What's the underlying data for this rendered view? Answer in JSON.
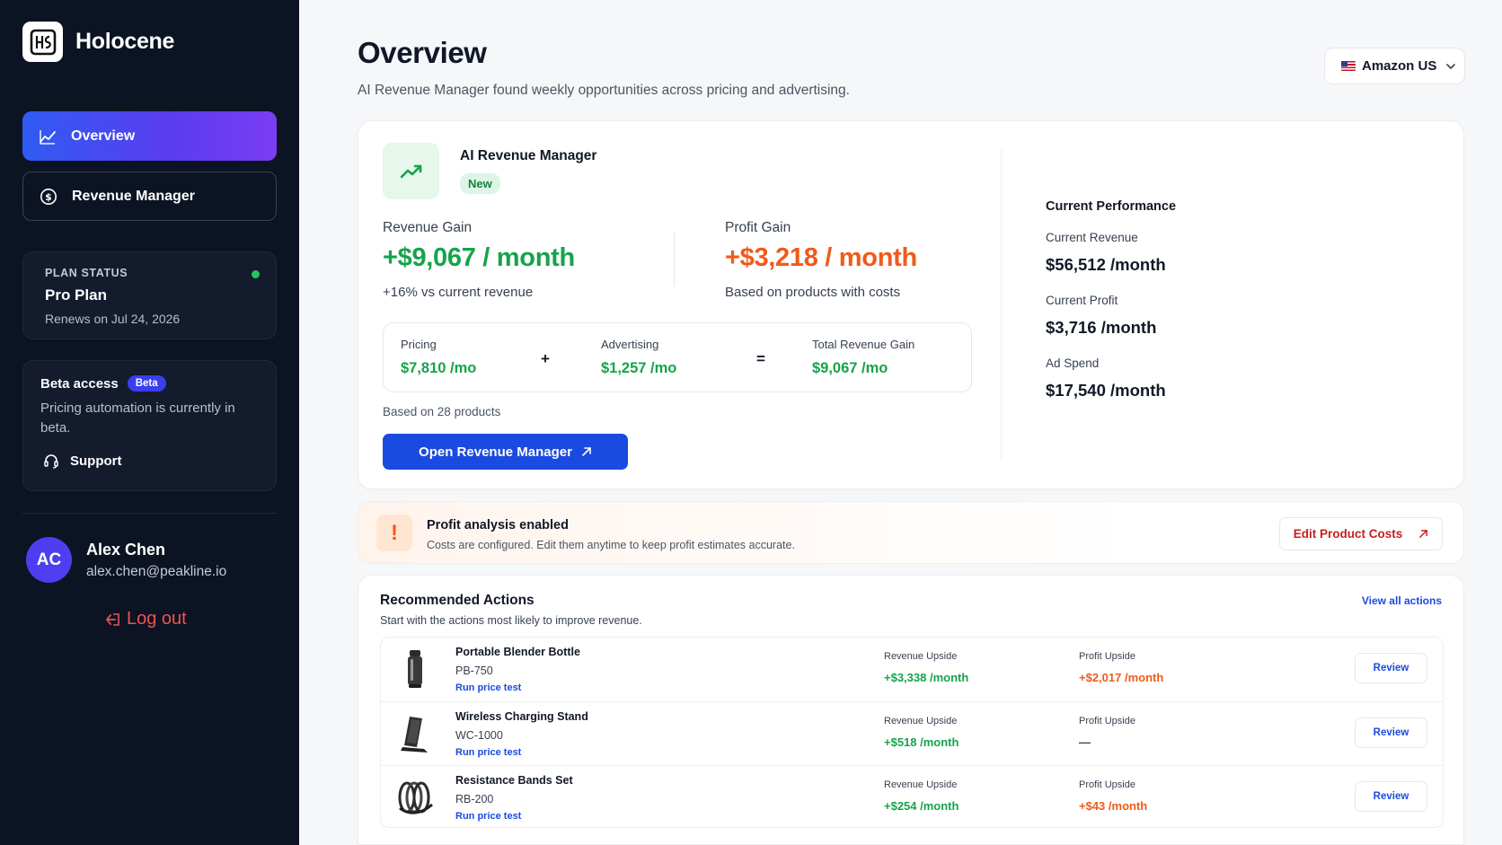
{
  "brand": {
    "name": "Holocene",
    "logo_icon": "holocene-logo-icon"
  },
  "nav": [
    {
      "label": "Overview",
      "icon": "trend-chart-icon",
      "active": true
    },
    {
      "label": "Revenue Manager",
      "icon": "dollar-circle-icon",
      "active": false
    }
  ],
  "plan": {
    "label": "PLAN STATUS",
    "name": "Pro Plan",
    "renews": "Renews on Jul 24, 2026",
    "status_color": "#22c55e"
  },
  "beta": {
    "title": "Beta access",
    "badge": "Beta",
    "text": "Pricing automation is currently in beta.",
    "support_label": "Support"
  },
  "user": {
    "initials": "AC",
    "name": "Alex Chen",
    "email": "alex.chen@peakline.io",
    "logout_label": "Log out"
  },
  "header": {
    "title": "Overview",
    "subtitle": "AI Revenue Manager found weekly opportunities across pricing and advertising.",
    "marketplace": "Amazon US"
  },
  "revenue_manager": {
    "title": "AI Revenue Manager",
    "badge": "New",
    "revenue_gain": {
      "label": "Revenue Gain",
      "value": "+$9,067 / month",
      "note": "+16% vs current revenue"
    },
    "profit_gain": {
      "label": "Profit Gain",
      "value": "+$3,218 / month",
      "note": "Based on products with costs"
    },
    "breakdown": {
      "pricing": {
        "label": "Pricing",
        "value": "$7,810 /mo"
      },
      "plus": "+",
      "advertising": {
        "label": "Advertising",
        "value": "$1,257 /mo"
      },
      "equals": "=",
      "total": {
        "label": "Total Revenue Gain",
        "value": "$9,067 /mo"
      }
    },
    "based_on": "Based on 28 products",
    "open_button": "Open Revenue Manager"
  },
  "performance": {
    "title": "Current Performance",
    "items": [
      {
        "label": "Current Revenue",
        "value": "$56,512 /month"
      },
      {
        "label": "Current Profit",
        "value": "$3,716 /month"
      },
      {
        "label": "Ad Spend",
        "value": "$17,540 /month"
      }
    ]
  },
  "profit_analysis": {
    "title": "Profit analysis enabled",
    "subtitle": "Costs are configured. Edit them anytime to keep profit estimates accurate.",
    "button": "Edit Product Costs"
  },
  "actions": {
    "title": "Recommended Actions",
    "subtitle": "Start with the actions most likely to improve revenue.",
    "view_all": "View all actions",
    "rows": [
      {
        "name": "Portable Blender Bottle",
        "sku": "PB-750",
        "action": "Run price test",
        "revenue_label": "Revenue Upside",
        "revenue": "+$3,338 /month",
        "profit_label": "Profit Upside",
        "profit": "+$2,017 /month",
        "review": "Review",
        "image": "blender-bottle-image"
      },
      {
        "name": "Wireless Charging Stand",
        "sku": "WC-1000",
        "action": "Run price test",
        "revenue_label": "Revenue Upside",
        "revenue": "+$518 /month",
        "profit_label": "Profit Upside",
        "profit": "—",
        "review": "Review",
        "image": "charging-stand-image"
      },
      {
        "name": "Resistance Bands Set",
        "sku": "RB-200",
        "action": "Run price test",
        "revenue_label": "Revenue Upside",
        "revenue": "+$254 /month",
        "profit_label": "Profit Upside",
        "profit": "+$43 /month",
        "review": "Review",
        "image": "resistance-bands-image"
      }
    ]
  },
  "colors": {
    "accent": "#1a4be0",
    "positive": "#16a34a",
    "profit": "#f05a1a",
    "sidebar": "#0c1322"
  }
}
